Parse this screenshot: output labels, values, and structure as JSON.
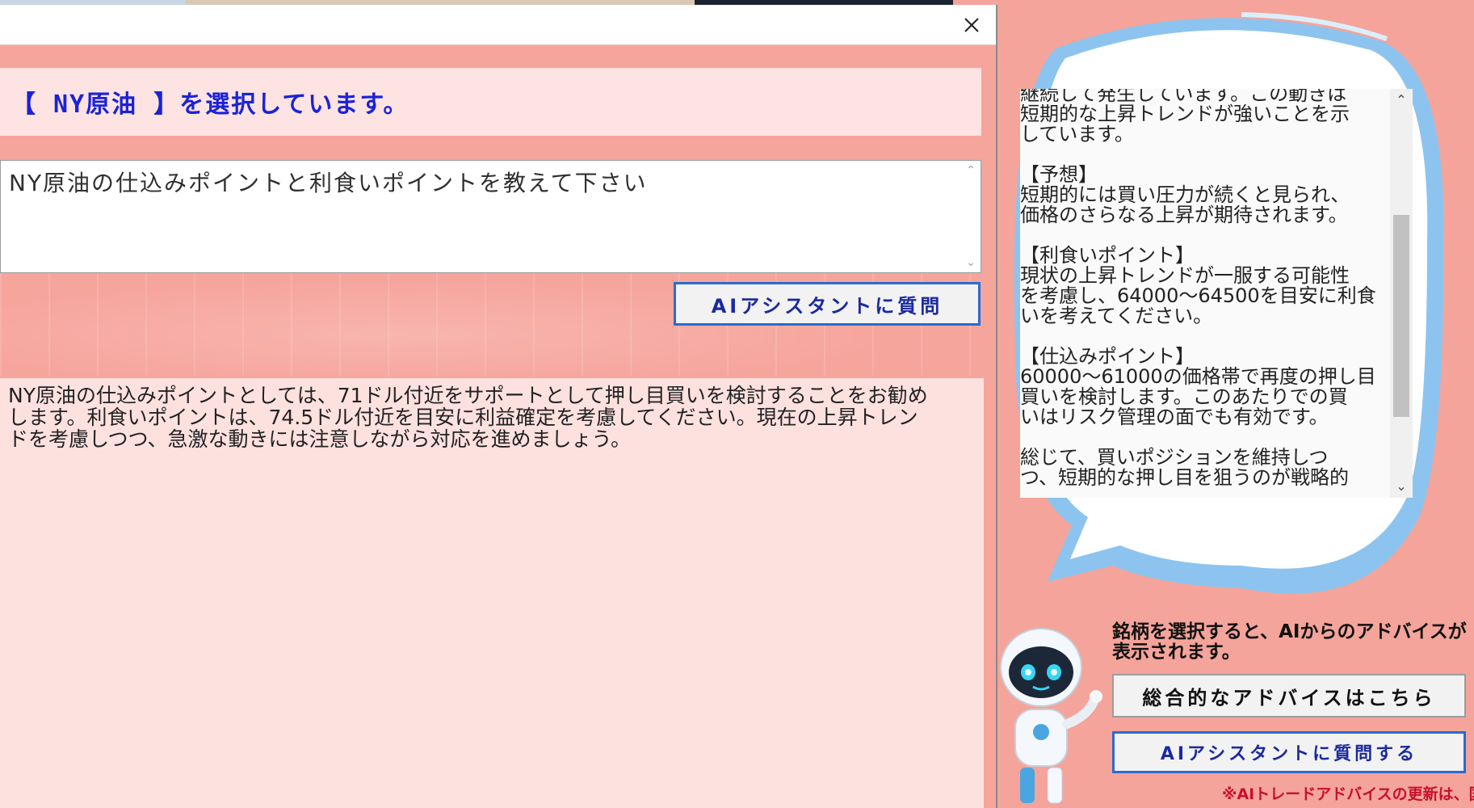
{
  "dialog": {
    "selected_banner": "【 NY原油 】を選択しています。",
    "question_text": "NY原油の仕込みポイントと利食いポイントを教えて下さい",
    "ask_button": "AIアシスタントに質問",
    "answer_text": "NY原油の仕込みポイントとしては、71ドル付近をサポートとして押し目買いを検討することをお勧めします。利食いポイントは、74.5ドル付近を目安に利益確定を考慮してください。現在の上昇トレンドを考慮しつつ、急激な動きには注意しながら対応を進めましょう。"
  },
  "right_panel": {
    "advice_text": "継続して発生しています。この動きは\n短期的な上昇トレンドが強いことを示\nしています。\n\n【予想】\n短期的には買い圧力が続くと見られ、\n価格のさらなる上昇が期待されます。\n\n【利食いポイント】\n現状の上昇トレンドが一服する可能性\nを考慮し、64000～64500を目安に利食\nいを考えてください。\n\n【仕込みポイント】\n60000～61000の価格帯で再度の押し目\n買いを検討します。このあたりでの買\nいはリスク管理の面でも有効です。\n\n総じて、買いポジションを維持しつ\nつ、短期的な押し目を狙うのが戦略的",
    "info_text": "銘柄を選択すると、AIからのアドバイスが表示されます。",
    "advice_button": "総合的なアドバイスはこちら",
    "assistant_button": "AIアシスタントに質問する",
    "notice": "※AIトレードアドバイスの更新は、国内"
  },
  "colors": {
    "accent_blue": "#2a6bd1",
    "banner_text": "#1a22d8",
    "notice_red": "#c8102e",
    "panel_pink": "#f4a49a"
  },
  "icons": {
    "close": "close-icon",
    "scroll_up": "chevron-up-icon",
    "scroll_down": "chevron-down-icon",
    "mascot": "robot-mascot-icon"
  }
}
